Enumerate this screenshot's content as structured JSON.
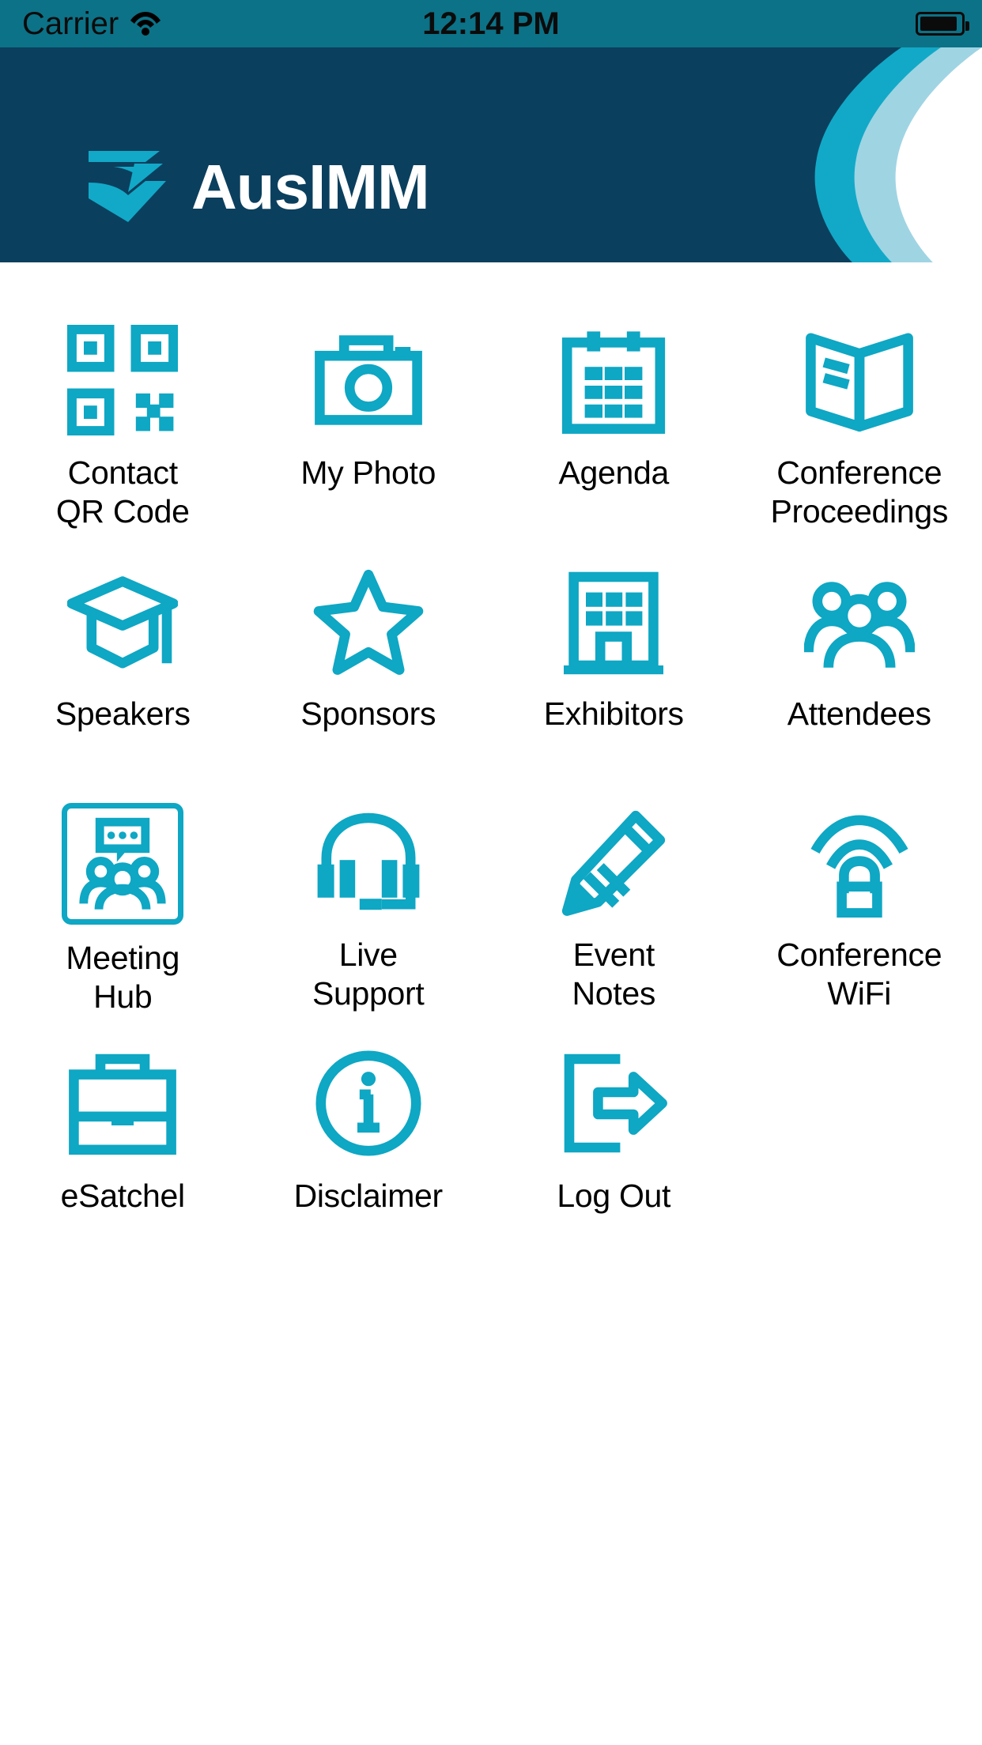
{
  "status_bar": {
    "carrier": "Carrier",
    "wifi_icon": "wifi-icon",
    "time": "12:14 PM",
    "battery_icon": "battery-full-icon"
  },
  "header": {
    "brand": "AusIMM",
    "logo_icon": "ausimm-logo-mark",
    "bg_color": "#0b3f5e",
    "accent_color": "#0ea7c4",
    "accent_light_color": "#9fd4e3"
  },
  "theme": {
    "icon_color": "#0ea7c4",
    "status_bar_color": "#0c7287",
    "label_color": "#000000",
    "page_background": "#ffffff"
  },
  "menu": {
    "items": [
      {
        "icon": "qr-code-icon",
        "line1": "Contact",
        "line2": "QR Code",
        "selected": false
      },
      {
        "icon": "camera-icon",
        "line1": "My Photo",
        "line2": "",
        "selected": false
      },
      {
        "icon": "calendar-icon",
        "line1": "Agenda",
        "line2": "",
        "selected": false
      },
      {
        "icon": "open-book-icon",
        "line1": "Conference",
        "line2": "Proceedings",
        "selected": false
      },
      {
        "icon": "graduation-cap-icon",
        "line1": "Speakers",
        "line2": "",
        "selected": false
      },
      {
        "icon": "star-icon",
        "line1": "Sponsors",
        "line2": "",
        "selected": false
      },
      {
        "icon": "building-icon",
        "line1": "Exhibitors",
        "line2": "",
        "selected": false
      },
      {
        "icon": "people-group-icon",
        "line1": "Attendees",
        "line2": "",
        "selected": false
      },
      {
        "icon": "meeting-hub-icon",
        "line1": "Meeting",
        "line2": "Hub",
        "selected": true
      },
      {
        "icon": "headset-icon",
        "line1": "Live",
        "line2": "Support",
        "selected": false
      },
      {
        "icon": "pencil-icon",
        "line1": "Event",
        "line2": "Notes",
        "selected": false
      },
      {
        "icon": "wifi-router-icon",
        "line1": "Conference",
        "line2": "WiFi",
        "selected": false
      },
      {
        "icon": "briefcase-icon",
        "line1": "eSatchel",
        "line2": "",
        "selected": false
      },
      {
        "icon": "info-circle-icon",
        "line1": "Disclaimer",
        "line2": "",
        "selected": false
      },
      {
        "icon": "logout-icon",
        "line1": "Log Out",
        "line2": "",
        "selected": false
      }
    ]
  }
}
